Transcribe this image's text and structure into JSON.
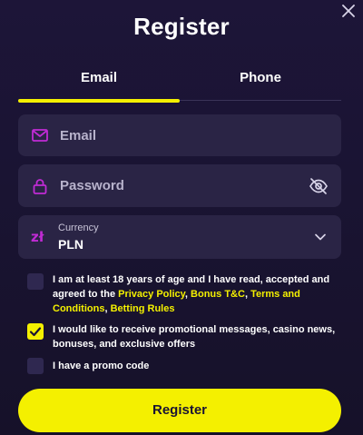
{
  "title": "Register",
  "tabs": [
    {
      "label": "Email",
      "active": true
    },
    {
      "label": "Phone",
      "active": false
    }
  ],
  "form": {
    "email_placeholder": "Email",
    "email_value": "",
    "password_placeholder": "Password",
    "password_value": "",
    "currency_label": "Currency",
    "currency_value": "PLN",
    "currency_symbol": "zł"
  },
  "checkboxes": {
    "terms": {
      "checked": false,
      "text_before": "I am at least 18 years of age and I have read, accepted and agreed to the ",
      "link_privacy": "Privacy Policy",
      "sep1": ", ",
      "link_bonus": "Bonus T&C",
      "sep2": ", ",
      "link_terms": "Terms and Conditions",
      "sep3": ", ",
      "link_betting": "Betting Rules"
    },
    "promotional": {
      "checked": true,
      "text": "I would like to receive promotional messages, casino news, bonuses, and exclusive offers"
    },
    "promo_code": {
      "checked": false,
      "text": "I have a promo code"
    }
  },
  "register_button_label": "Register",
  "colors": {
    "accent": "#f4f000",
    "icon_magenta": "#c02bd4",
    "background": "#1a1433",
    "field_bg": "#2a2445"
  },
  "icons": {
    "close": "close-icon",
    "email": "envelope-icon",
    "password": "lock-icon",
    "password_toggle": "eye-off-icon",
    "currency": "zloty-icon",
    "dropdown": "chevron-down-icon",
    "checkmark": "checkmark-icon"
  }
}
